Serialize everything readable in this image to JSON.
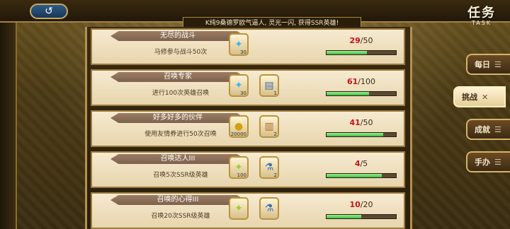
{
  "header": {
    "back_icon_glyph": "↺",
    "banner_text": "K纯9桑德罗欧气逼人, 灵光一闪, 获得SSR英雄!",
    "title": "任务",
    "subtitle": "TASK"
  },
  "tabs": [
    {
      "label": "每日",
      "icon": "☰",
      "active": false
    },
    {
      "label": "挑战",
      "icon": "✕",
      "active": true
    },
    {
      "label": "成就",
      "icon": "☰",
      "active": false
    },
    {
      "label": "手办",
      "icon": "☰",
      "active": false
    }
  ],
  "tasks": [
    {
      "name": "无尽的战斗",
      "desc": "马修参与战斗50次",
      "rewards": [
        {
          "icon": "rainbow-crystal-icon",
          "glyph": "✦",
          "qty": "30"
        }
      ],
      "progress": {
        "current": "29",
        "max": "/50",
        "fraction": 0.58
      }
    },
    {
      "name": "召唤专家",
      "desc": "进行100次英雄召唤",
      "rewards": [
        {
          "icon": "rainbow-crystal-icon",
          "glyph": "✦",
          "qty": "30"
        },
        {
          "icon": "summon-ticket-icon",
          "glyph": "▤",
          "qty": "1"
        }
      ],
      "progress": {
        "current": "61",
        "max": "/100",
        "fraction": 0.61
      }
    },
    {
      "name": "好多好多的伙伴",
      "desc": "使用友情券进行50次召唤",
      "rewards": [
        {
          "icon": "gold-coin-icon",
          "glyph": "●",
          "qty": "20000"
        },
        {
          "icon": "friendship-ticket-icon",
          "glyph": "▥",
          "qty": "2"
        }
      ],
      "progress": {
        "current": "41",
        "max": "/50",
        "fraction": 0.82
      }
    },
    {
      "name": "召唤达人III",
      "desc": "召唤5次SSR级英雄",
      "rewards": [
        {
          "icon": "rainbow-crystal-icon",
          "glyph": "✦",
          "qty": "100"
        },
        {
          "icon": "potion-icon",
          "glyph": "⚗",
          "qty": "2"
        }
      ],
      "progress": {
        "current": "4",
        "max": "/5",
        "fraction": 0.8
      }
    },
    {
      "name": "召唤的心得III",
      "desc": "召唤20次SSR级英雄",
      "rewards": [
        {
          "icon": "rainbow-crystal-icon",
          "glyph": "✦",
          "qty": ""
        },
        {
          "icon": "potion-icon",
          "glyph": "⚗",
          "qty": ""
        }
      ],
      "progress": {
        "current": "10",
        "max": "/20",
        "fraction": 0.5
      }
    }
  ]
}
